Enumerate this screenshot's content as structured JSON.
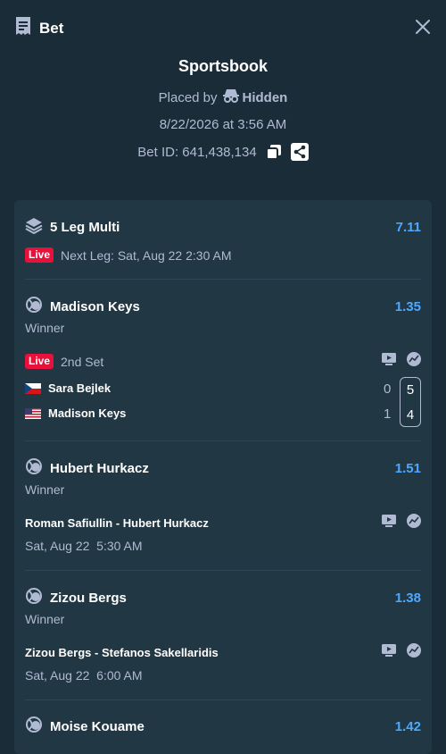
{
  "header": {
    "title": "Bet"
  },
  "summary": {
    "book": "Sportsbook",
    "placed_prefix": "Placed by",
    "placed_user": "Hidden",
    "date": "8/22/2026 at 3:56 AM",
    "bet_id": "Bet ID: 641,438,134"
  },
  "multi": {
    "title": "5 Leg Multi",
    "odds": "7.11",
    "live": "Live",
    "next_leg": "Next Leg: Sat, Aug 22 2:30 AM"
  },
  "legs": [
    {
      "name": "Madison Keys",
      "odds": "1.35",
      "market": "Winner",
      "live": "Live",
      "status": "2nd Set",
      "players": [
        {
          "name": "Sara Bejlek",
          "flag": "czech",
          "set1": "0",
          "set2": "5"
        },
        {
          "name": "Madison Keys",
          "flag": "usa",
          "set1": "1",
          "set2": "4"
        }
      ]
    },
    {
      "name": "Hubert Hurkacz",
      "odds": "1.51",
      "market": "Winner",
      "match": "Roman Safiullin - Hubert Hurkacz",
      "time": "Sat, Aug 22  5:30 AM"
    },
    {
      "name": "Zizou Bergs",
      "odds": "1.38",
      "market": "Winner",
      "match": "Zizou Bergs - Stefanos Sakellaridis",
      "time": "Sat, Aug 22  6:00 AM"
    },
    {
      "name": "Moise Kouame",
      "odds": "1.42"
    }
  ],
  "colors": {
    "background": "#1a2c38",
    "card": "#213743",
    "accent": "#4fa8ff",
    "live": "#e9113c",
    "muted": "#b1bad3"
  }
}
